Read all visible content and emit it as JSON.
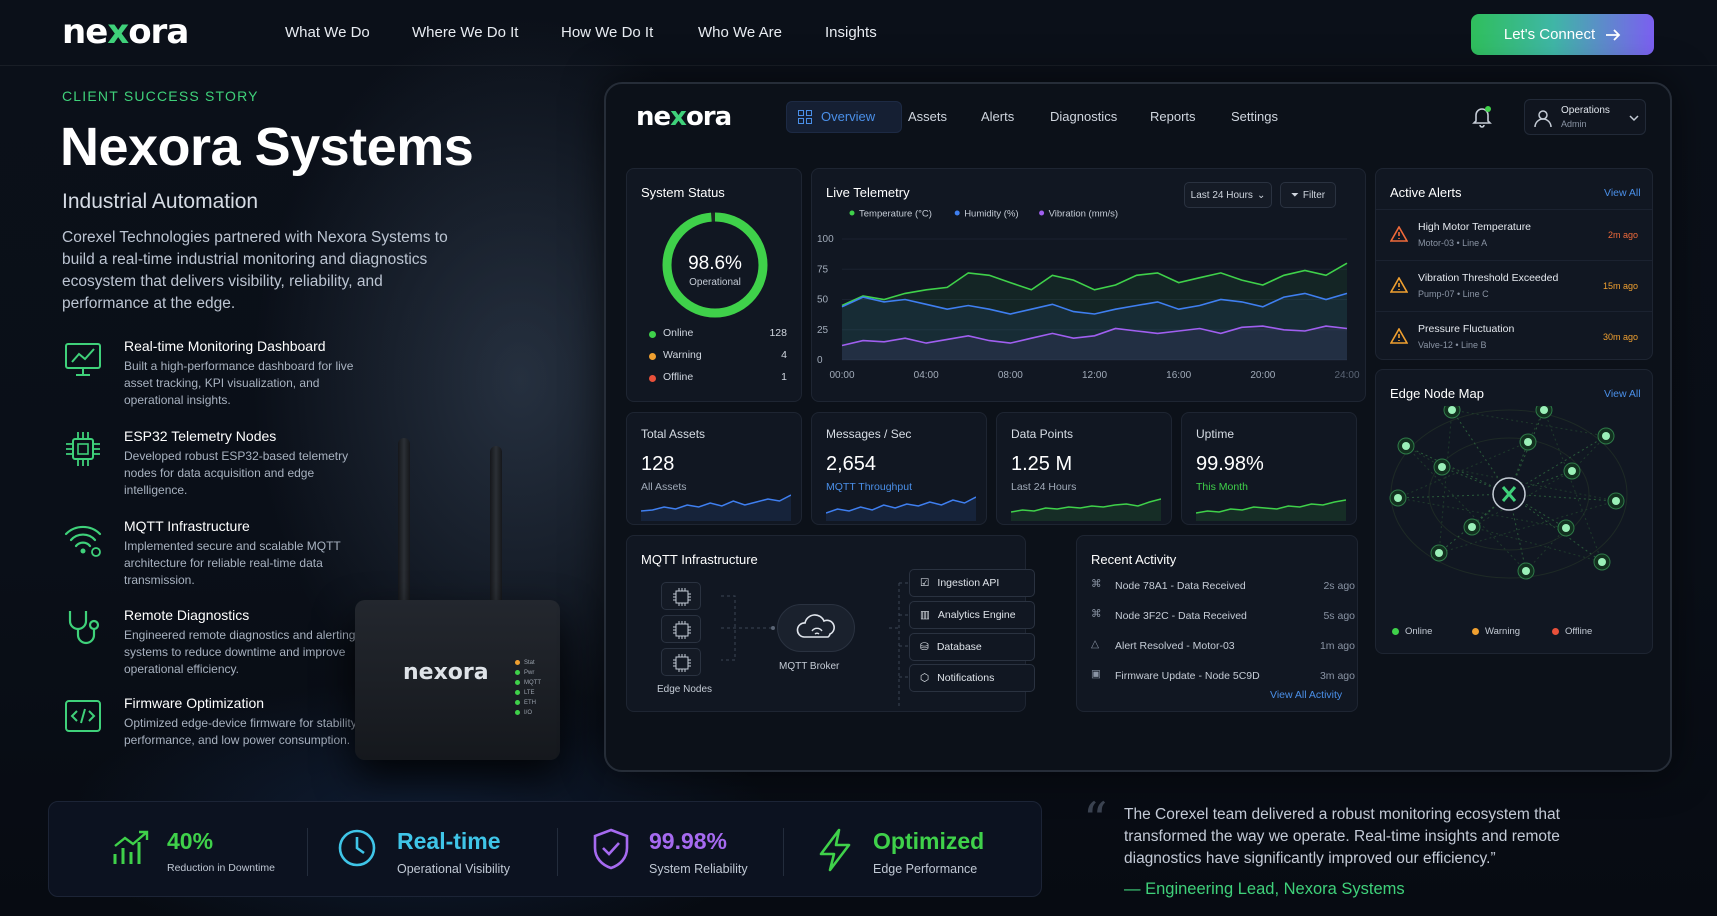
{
  "nav": {
    "logo": "nexora",
    "links": [
      "What We Do",
      "Where We Do It",
      "How We Do It",
      "Who We Are",
      "Insights"
    ],
    "cta_label": "Let's Connect"
  },
  "hero": {
    "eyebrow": "CLIENT SUCCESS STORY",
    "title": "Nexora Systems",
    "subtitle": "Industrial Automation",
    "intro": "Corexel Technologies partnered with Nexora Systems to build a real-time industrial monitoring and diagnostics ecosystem that delivers visibility, reliability, and performance at the edge.",
    "features": [
      {
        "title": "Real-time Monitoring Dashboard",
        "desc": "Built a high-performance dashboard for live asset tracking, KPI visualization, and operational insights.",
        "icon": "monitor-chart-icon"
      },
      {
        "title": "ESP32 Telemetry Nodes",
        "desc": "Developed robust ESP32-based telemetry nodes for data acquisition and edge intelligence.",
        "icon": "chip-icon"
      },
      {
        "title": "MQTT Infrastructure",
        "desc": "Implemented secure and scalable MQTT architecture for reliable real-time data transmission.",
        "icon": "wifi-icon"
      },
      {
        "title": "Remote Diagnostics",
        "desc": "Engineered remote diagnostics and alerting systems to reduce downtime and improve operational efficiency.",
        "icon": "stethoscope-icon"
      },
      {
        "title": "Firmware Optimization",
        "desc": "Optimized edge-device firmware for stability, performance, and low power consumption.",
        "icon": "code-icon"
      }
    ],
    "device_label": "nexora",
    "device_leds": [
      "Stat",
      "Pwr",
      "MQTT",
      "LTE",
      "ETH",
      "I/O"
    ]
  },
  "dashboard": {
    "logo": "nexora",
    "tabs": [
      "Overview",
      "Assets",
      "Alerts",
      "Diagnostics",
      "Reports",
      "Settings"
    ],
    "user": {
      "name": "Operations",
      "role": "Admin"
    },
    "system_status": {
      "title": "System Status",
      "value": "98.6%",
      "fraction": 0.986,
      "label": "Operational",
      "rows": [
        {
          "label": "Online",
          "count": "128",
          "color": "#3fd14a"
        },
        {
          "label": "Warning",
          "count": "4",
          "color": "#f0a030"
        },
        {
          "label": "Offline",
          "count": "1",
          "color": "#e8503a"
        }
      ]
    },
    "telemetry": {
      "title": "Live Telemetry",
      "range_label": "Last 24 Hours",
      "filter_label": "Filter"
    },
    "alerts": {
      "title": "Active Alerts",
      "view_all": "View All",
      "items": [
        {
          "title": "High Motor Temperature",
          "source": "Motor-03",
          "line": "Line A",
          "time": "2m ago",
          "color": "#f06a3a"
        },
        {
          "title": "Vibration Threshold Exceeded",
          "source": "Pump-07",
          "line": "Line C",
          "time": "15m ago",
          "color": "#f0a030"
        },
        {
          "title": "Pressure Fluctuation",
          "source": "Valve-12",
          "line": "Line B",
          "time": "30m ago",
          "color": "#f0a030"
        }
      ]
    },
    "kpis": [
      {
        "label": "Total Assets",
        "value": "128",
        "note": "All Assets",
        "note_color": "#a1abb9"
      },
      {
        "label": "Messages / Sec",
        "value": "2,654",
        "note": "MQTT Throughput",
        "note_color": "#4a8fe8"
      },
      {
        "label": "Data Points",
        "value": "1.25 M",
        "note": "Last 24 Hours",
        "note_color": "#a1abb9"
      },
      {
        "label": "Uptime",
        "value": "99.98%",
        "note": "This Month",
        "note_color": "#3fd14a"
      }
    ],
    "mqtt": {
      "title": "MQTT Infrastructure",
      "edge_label": "Edge Nodes",
      "broker_label": "MQTT Broker",
      "targets": [
        "Ingestion API",
        "Analytics Engine",
        "Database",
        "Notifications"
      ]
    },
    "activity": {
      "title": "Recent Activity",
      "view_all": "View All Activity",
      "items": [
        {
          "text": "Node 78A1 - Data Received",
          "time": "2s ago"
        },
        {
          "text": "Node 3F2C - Data Received",
          "time": "5s ago"
        },
        {
          "text": "Alert Resolved - Motor-03",
          "time": "1m ago"
        },
        {
          "text": "Firmware Update - Node 5C9D",
          "time": "3m ago"
        }
      ]
    },
    "edge_map": {
      "title": "Edge Node Map",
      "view_all": "View All",
      "legend": [
        {
          "label": "Online",
          "color": "#3fd14a"
        },
        {
          "label": "Warning",
          "color": "#f0a030"
        },
        {
          "label": "Offline",
          "color": "#e8503a"
        }
      ]
    }
  },
  "chart_data": {
    "type": "line",
    "title": "Live Telemetry",
    "x": [
      "00:00",
      "04:00",
      "08:00",
      "12:00",
      "16:00",
      "20:00",
      "24:00"
    ],
    "ylim": [
      0,
      100
    ],
    "yticks": [
      "0",
      "25",
      "50",
      "75",
      "100"
    ],
    "grid": true,
    "legend": "top",
    "series": [
      {
        "name": "Temperature (°C)",
        "color": "#3fd14a",
        "values": [
          45,
          53,
          50,
          55,
          58,
          60,
          72,
          70,
          64,
          58,
          70,
          66,
          58,
          62,
          70,
          72,
          64,
          68,
          72,
          66,
          62,
          70,
          74,
          70,
          80
        ]
      },
      {
        "name": "Humidity (%)",
        "color": "#3f7ff0",
        "values": [
          44,
          52,
          48,
          50,
          46,
          42,
          45,
          42,
          38,
          42,
          46,
          40,
          38,
          42,
          45,
          48,
          42,
          45,
          50,
          48,
          44,
          52,
          55,
          50,
          55
        ]
      },
      {
        "name": "Vibration (mm/s)",
        "color": "#a05ff0",
        "values": [
          12,
          16,
          15,
          18,
          14,
          17,
          20,
          16,
          14,
          18,
          22,
          18,
          20,
          26,
          24,
          22,
          24,
          26,
          22,
          27,
          28,
          25,
          24,
          28,
          26
        ]
      }
    ]
  },
  "stats": [
    {
      "value": "40%",
      "caption": "Reduction in Downtime",
      "color": "#3fd14a",
      "icon": "trend-up-icon"
    },
    {
      "value": "Real-time",
      "caption": "Operational Visibility",
      "color": "#3fc5e8",
      "icon": "clock-icon"
    },
    {
      "value": "99.98%",
      "caption": "System Reliability",
      "color": "#a66af0",
      "icon": "shield-check-icon"
    },
    {
      "value": "Optimized",
      "caption": "Edge Performance",
      "color": "#3fd14a",
      "icon": "lightning-icon"
    }
  ],
  "testimonial": {
    "quote": "The Corexel team delivered a robust monitoring ecosystem that transformed the way we operate. Real-time insights and remote diagnostics have significantly improved our efficiency.”",
    "author": "— Engineering Lead, Nexora Systems"
  }
}
